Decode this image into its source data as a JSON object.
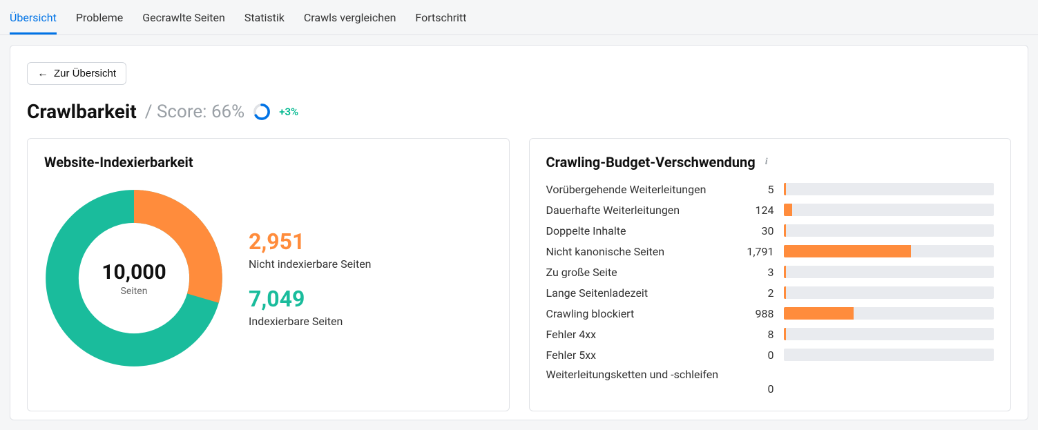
{
  "tabs": [
    {
      "label": "Übersicht",
      "active": true
    },
    {
      "label": "Probleme",
      "active": false
    },
    {
      "label": "Gecrawlte Seiten",
      "active": false
    },
    {
      "label": "Statistik",
      "active": false
    },
    {
      "label": "Crawls vergleichen",
      "active": false
    },
    {
      "label": "Fortschritt",
      "active": false
    }
  ],
  "back_button": {
    "label": "Zur Übersicht"
  },
  "header": {
    "title": "Crawlbarkeit",
    "score_prefix": "/ Score:",
    "score_value": "66%",
    "score_pct": 66,
    "delta": "+3%"
  },
  "indexability": {
    "title": "Website-Indexierbarkeit",
    "total_value": "10,000",
    "total_label": "Seiten",
    "non_indexable_value": "2,951",
    "non_indexable_label": "Nicht indexierbare Seiten",
    "indexable_value": "7,049",
    "indexable_label": "Indexierbare Seiten",
    "non_indexable_pct": 29.5
  },
  "budget": {
    "title": "Crawling-Budget-Verschwendung",
    "max": 2951,
    "rows": [
      {
        "name": "Vorübergehende Weiterleitungen",
        "value": 5
      },
      {
        "name": "Dauerhafte Weiterleitungen",
        "value": 124
      },
      {
        "name": "Doppelte Inhalte",
        "value": 30
      },
      {
        "name": "Nicht kanonische Seiten",
        "value": 1791,
        "display": "1,791"
      },
      {
        "name": "Zu große Seite",
        "value": 3
      },
      {
        "name": "Lange Seitenladezeit",
        "value": 2
      },
      {
        "name": "Crawling blockiert",
        "value": 988
      },
      {
        "name": "Fehler 4xx",
        "value": 8
      },
      {
        "name": "Fehler 5xx",
        "value": 0
      }
    ],
    "last_row": {
      "name": "Weiterleitungsketten und -schleifen",
      "value": 0
    }
  },
  "chart_data": [
    {
      "type": "pie",
      "title": "Website-Indexierbarkeit",
      "series": [
        {
          "name": "Nicht indexierbare Seiten",
          "value": 2951,
          "color": "#ff8c3c"
        },
        {
          "name": "Indexierbare Seiten",
          "value": 7049,
          "color": "#1abc9c"
        }
      ],
      "total_label": "Seiten",
      "total": 10000
    },
    {
      "type": "bar",
      "title": "Crawling-Budget-Verschwendung",
      "orientation": "horizontal",
      "categories": [
        "Vorübergehende Weiterleitungen",
        "Dauerhafte Weiterleitungen",
        "Doppelte Inhalte",
        "Nicht kanonische Seiten",
        "Zu große Seite",
        "Lange Seitenladezeit",
        "Crawling blockiert",
        "Fehler 4xx",
        "Fehler 5xx",
        "Weiterleitungsketten und -schleifen"
      ],
      "values": [
        5,
        124,
        30,
        1791,
        3,
        2,
        988,
        8,
        0,
        0
      ],
      "xlabel": "",
      "ylabel": "",
      "ylim": [
        0,
        2951
      ],
      "color": "#ff8c3c"
    },
    {
      "type": "pie",
      "title": "Score",
      "series": [
        {
          "name": "Score",
          "value": 66,
          "color": "#0073e6"
        },
        {
          "name": "Remaining",
          "value": 34,
          "color": "#e0e2e6"
        }
      ]
    }
  ]
}
